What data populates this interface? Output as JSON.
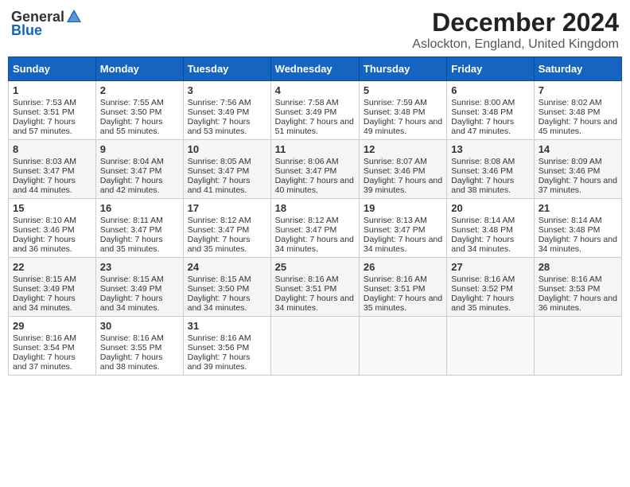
{
  "logo": {
    "general": "General",
    "blue": "Blue"
  },
  "title": "December 2024",
  "subtitle": "Aslockton, England, United Kingdom",
  "days_of_week": [
    "Sunday",
    "Monday",
    "Tuesday",
    "Wednesday",
    "Thursday",
    "Friday",
    "Saturday"
  ],
  "weeks": [
    [
      {
        "day": "1",
        "sunrise": "Sunrise: 7:53 AM",
        "sunset": "Sunset: 3:51 PM",
        "daylight": "Daylight: 7 hours and 57 minutes."
      },
      {
        "day": "2",
        "sunrise": "Sunrise: 7:55 AM",
        "sunset": "Sunset: 3:50 PM",
        "daylight": "Daylight: 7 hours and 55 minutes."
      },
      {
        "day": "3",
        "sunrise": "Sunrise: 7:56 AM",
        "sunset": "Sunset: 3:49 PM",
        "daylight": "Daylight: 7 hours and 53 minutes."
      },
      {
        "day": "4",
        "sunrise": "Sunrise: 7:58 AM",
        "sunset": "Sunset: 3:49 PM",
        "daylight": "Daylight: 7 hours and 51 minutes."
      },
      {
        "day": "5",
        "sunrise": "Sunrise: 7:59 AM",
        "sunset": "Sunset: 3:48 PM",
        "daylight": "Daylight: 7 hours and 49 minutes."
      },
      {
        "day": "6",
        "sunrise": "Sunrise: 8:00 AM",
        "sunset": "Sunset: 3:48 PM",
        "daylight": "Daylight: 7 hours and 47 minutes."
      },
      {
        "day": "7",
        "sunrise": "Sunrise: 8:02 AM",
        "sunset": "Sunset: 3:48 PM",
        "daylight": "Daylight: 7 hours and 45 minutes."
      }
    ],
    [
      {
        "day": "8",
        "sunrise": "Sunrise: 8:03 AM",
        "sunset": "Sunset: 3:47 PM",
        "daylight": "Daylight: 7 hours and 44 minutes."
      },
      {
        "day": "9",
        "sunrise": "Sunrise: 8:04 AM",
        "sunset": "Sunset: 3:47 PM",
        "daylight": "Daylight: 7 hours and 42 minutes."
      },
      {
        "day": "10",
        "sunrise": "Sunrise: 8:05 AM",
        "sunset": "Sunset: 3:47 PM",
        "daylight": "Daylight: 7 hours and 41 minutes."
      },
      {
        "day": "11",
        "sunrise": "Sunrise: 8:06 AM",
        "sunset": "Sunset: 3:47 PM",
        "daylight": "Daylight: 7 hours and 40 minutes."
      },
      {
        "day": "12",
        "sunrise": "Sunrise: 8:07 AM",
        "sunset": "Sunset: 3:46 PM",
        "daylight": "Daylight: 7 hours and 39 minutes."
      },
      {
        "day": "13",
        "sunrise": "Sunrise: 8:08 AM",
        "sunset": "Sunset: 3:46 PM",
        "daylight": "Daylight: 7 hours and 38 minutes."
      },
      {
        "day": "14",
        "sunrise": "Sunrise: 8:09 AM",
        "sunset": "Sunset: 3:46 PM",
        "daylight": "Daylight: 7 hours and 37 minutes."
      }
    ],
    [
      {
        "day": "15",
        "sunrise": "Sunrise: 8:10 AM",
        "sunset": "Sunset: 3:46 PM",
        "daylight": "Daylight: 7 hours and 36 minutes."
      },
      {
        "day": "16",
        "sunrise": "Sunrise: 8:11 AM",
        "sunset": "Sunset: 3:47 PM",
        "daylight": "Daylight: 7 hours and 35 minutes."
      },
      {
        "day": "17",
        "sunrise": "Sunrise: 8:12 AM",
        "sunset": "Sunset: 3:47 PM",
        "daylight": "Daylight: 7 hours and 35 minutes."
      },
      {
        "day": "18",
        "sunrise": "Sunrise: 8:12 AM",
        "sunset": "Sunset: 3:47 PM",
        "daylight": "Daylight: 7 hours and 34 minutes."
      },
      {
        "day": "19",
        "sunrise": "Sunrise: 8:13 AM",
        "sunset": "Sunset: 3:47 PM",
        "daylight": "Daylight: 7 hours and 34 minutes."
      },
      {
        "day": "20",
        "sunrise": "Sunrise: 8:14 AM",
        "sunset": "Sunset: 3:48 PM",
        "daylight": "Daylight: 7 hours and 34 minutes."
      },
      {
        "day": "21",
        "sunrise": "Sunrise: 8:14 AM",
        "sunset": "Sunset: 3:48 PM",
        "daylight": "Daylight: 7 hours and 34 minutes."
      }
    ],
    [
      {
        "day": "22",
        "sunrise": "Sunrise: 8:15 AM",
        "sunset": "Sunset: 3:49 PM",
        "daylight": "Daylight: 7 hours and 34 minutes."
      },
      {
        "day": "23",
        "sunrise": "Sunrise: 8:15 AM",
        "sunset": "Sunset: 3:49 PM",
        "daylight": "Daylight: 7 hours and 34 minutes."
      },
      {
        "day": "24",
        "sunrise": "Sunrise: 8:15 AM",
        "sunset": "Sunset: 3:50 PM",
        "daylight": "Daylight: 7 hours and 34 minutes."
      },
      {
        "day": "25",
        "sunrise": "Sunrise: 8:16 AM",
        "sunset": "Sunset: 3:51 PM",
        "daylight": "Daylight: 7 hours and 34 minutes."
      },
      {
        "day": "26",
        "sunrise": "Sunrise: 8:16 AM",
        "sunset": "Sunset: 3:51 PM",
        "daylight": "Daylight: 7 hours and 35 minutes."
      },
      {
        "day": "27",
        "sunrise": "Sunrise: 8:16 AM",
        "sunset": "Sunset: 3:52 PM",
        "daylight": "Daylight: 7 hours and 35 minutes."
      },
      {
        "day": "28",
        "sunrise": "Sunrise: 8:16 AM",
        "sunset": "Sunset: 3:53 PM",
        "daylight": "Daylight: 7 hours and 36 minutes."
      }
    ],
    [
      {
        "day": "29",
        "sunrise": "Sunrise: 8:16 AM",
        "sunset": "Sunset: 3:54 PM",
        "daylight": "Daylight: 7 hours and 37 minutes."
      },
      {
        "day": "30",
        "sunrise": "Sunrise: 8:16 AM",
        "sunset": "Sunset: 3:55 PM",
        "daylight": "Daylight: 7 hours and 38 minutes."
      },
      {
        "day": "31",
        "sunrise": "Sunrise: 8:16 AM",
        "sunset": "Sunset: 3:56 PM",
        "daylight": "Daylight: 7 hours and 39 minutes."
      },
      {
        "day": "",
        "sunrise": "",
        "sunset": "",
        "daylight": ""
      },
      {
        "day": "",
        "sunrise": "",
        "sunset": "",
        "daylight": ""
      },
      {
        "day": "",
        "sunrise": "",
        "sunset": "",
        "daylight": ""
      },
      {
        "day": "",
        "sunrise": "",
        "sunset": "",
        "daylight": ""
      }
    ]
  ]
}
